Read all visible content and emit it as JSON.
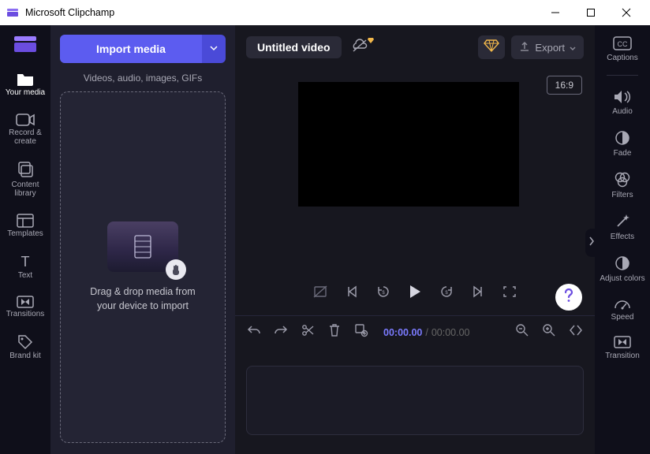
{
  "titlebar": {
    "title": "Microsoft Clipchamp"
  },
  "leftnav": {
    "items": [
      {
        "label": "Your media",
        "icon": "folder"
      },
      {
        "label": "Record & create",
        "icon": "camera"
      },
      {
        "label": "Content library",
        "icon": "library"
      },
      {
        "label": "Templates",
        "icon": "templates"
      },
      {
        "label": "Text",
        "icon": "text"
      },
      {
        "label": "Transitions",
        "icon": "transitions"
      },
      {
        "label": "Brand kit",
        "icon": "tag"
      }
    ]
  },
  "media": {
    "import_label": "Import media",
    "hint": "Videos, audio, images, GIFs",
    "drop_l1": "Drag & drop media from",
    "drop_l2": "your device to import"
  },
  "top": {
    "video_title": "Untitled video",
    "export_label": "Export",
    "aspect_ratio": "16:9"
  },
  "time": {
    "current": "00:00.00",
    "separator": "/",
    "total": "00:00.00"
  },
  "rightnav": {
    "items": [
      {
        "label": "Captions",
        "icon": "captions"
      },
      {
        "label": "Audio",
        "icon": "audio"
      },
      {
        "label": "Fade",
        "icon": "fade"
      },
      {
        "label": "Filters",
        "icon": "filters"
      },
      {
        "label": "Effects",
        "icon": "effects"
      },
      {
        "label": "Adjust colors",
        "icon": "adjust"
      },
      {
        "label": "Speed",
        "icon": "speed"
      },
      {
        "label": "Transition",
        "icon": "transition"
      }
    ]
  }
}
